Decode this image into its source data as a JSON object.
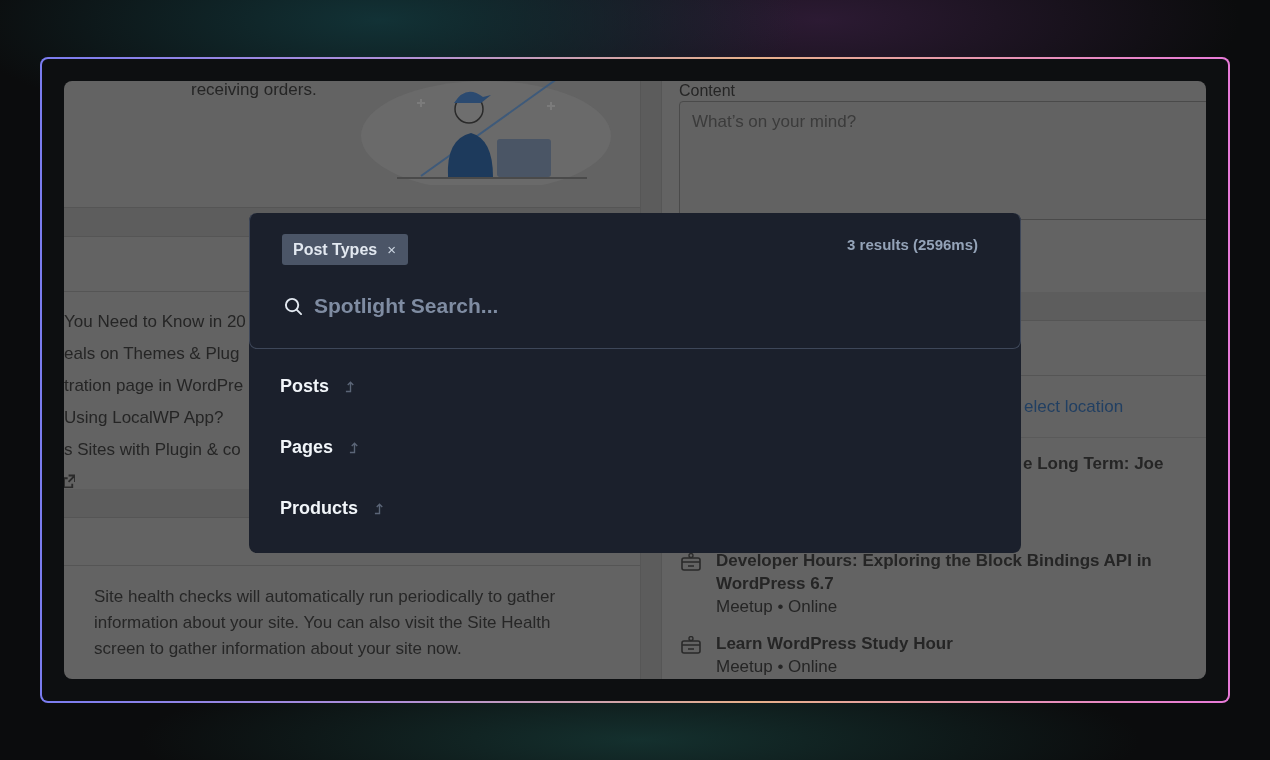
{
  "dashboard": {
    "welcome_text": "receiving orders.",
    "news_items": [
      {
        "text": "You Need to Know in 20"
      },
      {
        "text": "eals on Themes & Plug"
      },
      {
        "text": "tration page in WordPre"
      },
      {
        "text": "Using LocalWP App?"
      },
      {
        "text": "s Sites with Plugin & co"
      }
    ],
    "site_health_text": "Site health checks will automatically run periodically to gather information about your site. You can also visit the Site Health screen to gather information about your site now.",
    "content_label": "Content",
    "content_placeholder": "What’s on your mind?",
    "location_link": "elect location",
    "event_fragment": "e Long Term: Joe",
    "events": [
      {
        "title": "Developer Hours: Exploring the Block Bindings API in WordPress 6.7",
        "meta": "Meetup • Online"
      },
      {
        "title": "Learn WordPress Study Hour",
        "meta": "Meetup • Online"
      }
    ]
  },
  "spotlight": {
    "filter_chip": {
      "label": "Post Types",
      "remove": "×"
    },
    "result_count": "3 results (2596ms)",
    "search_placeholder": "Spotlight Search...",
    "results": [
      {
        "label": "Posts"
      },
      {
        "label": "Pages"
      },
      {
        "label": "Products"
      }
    ]
  }
}
